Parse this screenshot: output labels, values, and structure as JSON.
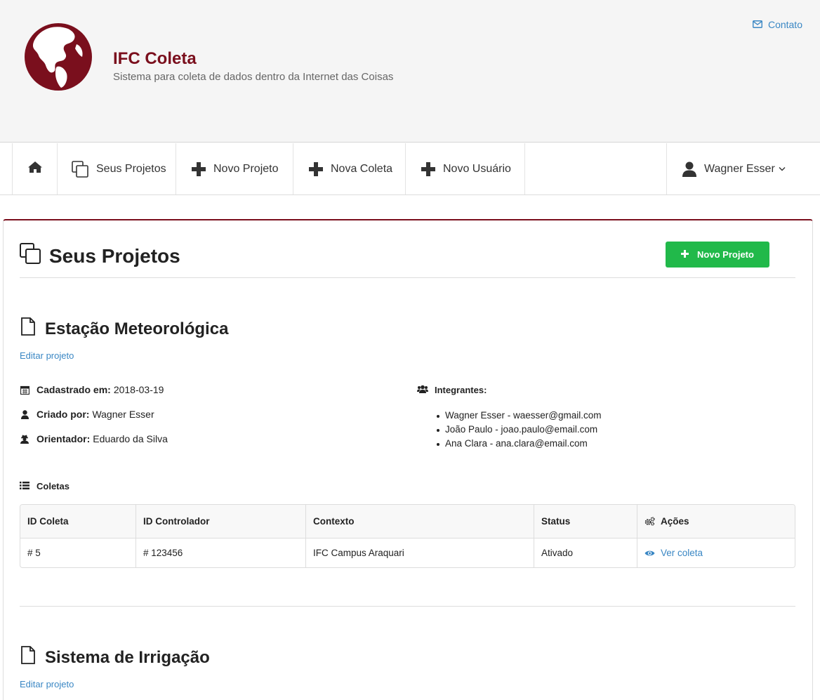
{
  "header": {
    "title": "IFC Coleta",
    "subtitle": "Sistema para coleta de dados dentro da Internet das Coisas",
    "contact_label": "Contato"
  },
  "nav": {
    "items": [
      {
        "label": "Seus Projetos"
      },
      {
        "label": "Novo Projeto"
      },
      {
        "label": "Nova Coleta"
      },
      {
        "label": "Novo Usuário"
      }
    ],
    "user_name": "Wagner Esser"
  },
  "page": {
    "title": "Seus Projetos",
    "new_button_label": "Novo Projeto"
  },
  "projects": [
    {
      "title": "Estação Meteorológica",
      "edit_label": "Editar projeto",
      "registered_label": "Cadastrado em:",
      "registered_value": "2018-03-19",
      "created_label": "Criado por:",
      "created_value": "Wagner Esser",
      "advisor_label": "Orientador:",
      "advisor_value": "Eduardo da Silva",
      "members_label": "Integrantes:",
      "members": [
        "Wagner Esser - waesser@gmail.com",
        "João Paulo - joao.paulo@email.com",
        "Ana Clara - ana.clara@email.com"
      ],
      "coletas_label": "Coletas",
      "table": {
        "headers": [
          "ID Coleta",
          "ID Controlador",
          "Contexto",
          "Status",
          "Ações"
        ],
        "rows": [
          {
            "id": "# 5",
            "controller": "# 123456",
            "context": "IFC Campus Araquari",
            "status": "Ativado",
            "action": "Ver coleta"
          }
        ]
      }
    },
    {
      "title": "Sistema de Irrigação",
      "edit_label": "Editar projeto"
    }
  ],
  "colors": {
    "brand": "#7a0f1d",
    "success": "#21b94a",
    "link": "#3a87c4"
  }
}
